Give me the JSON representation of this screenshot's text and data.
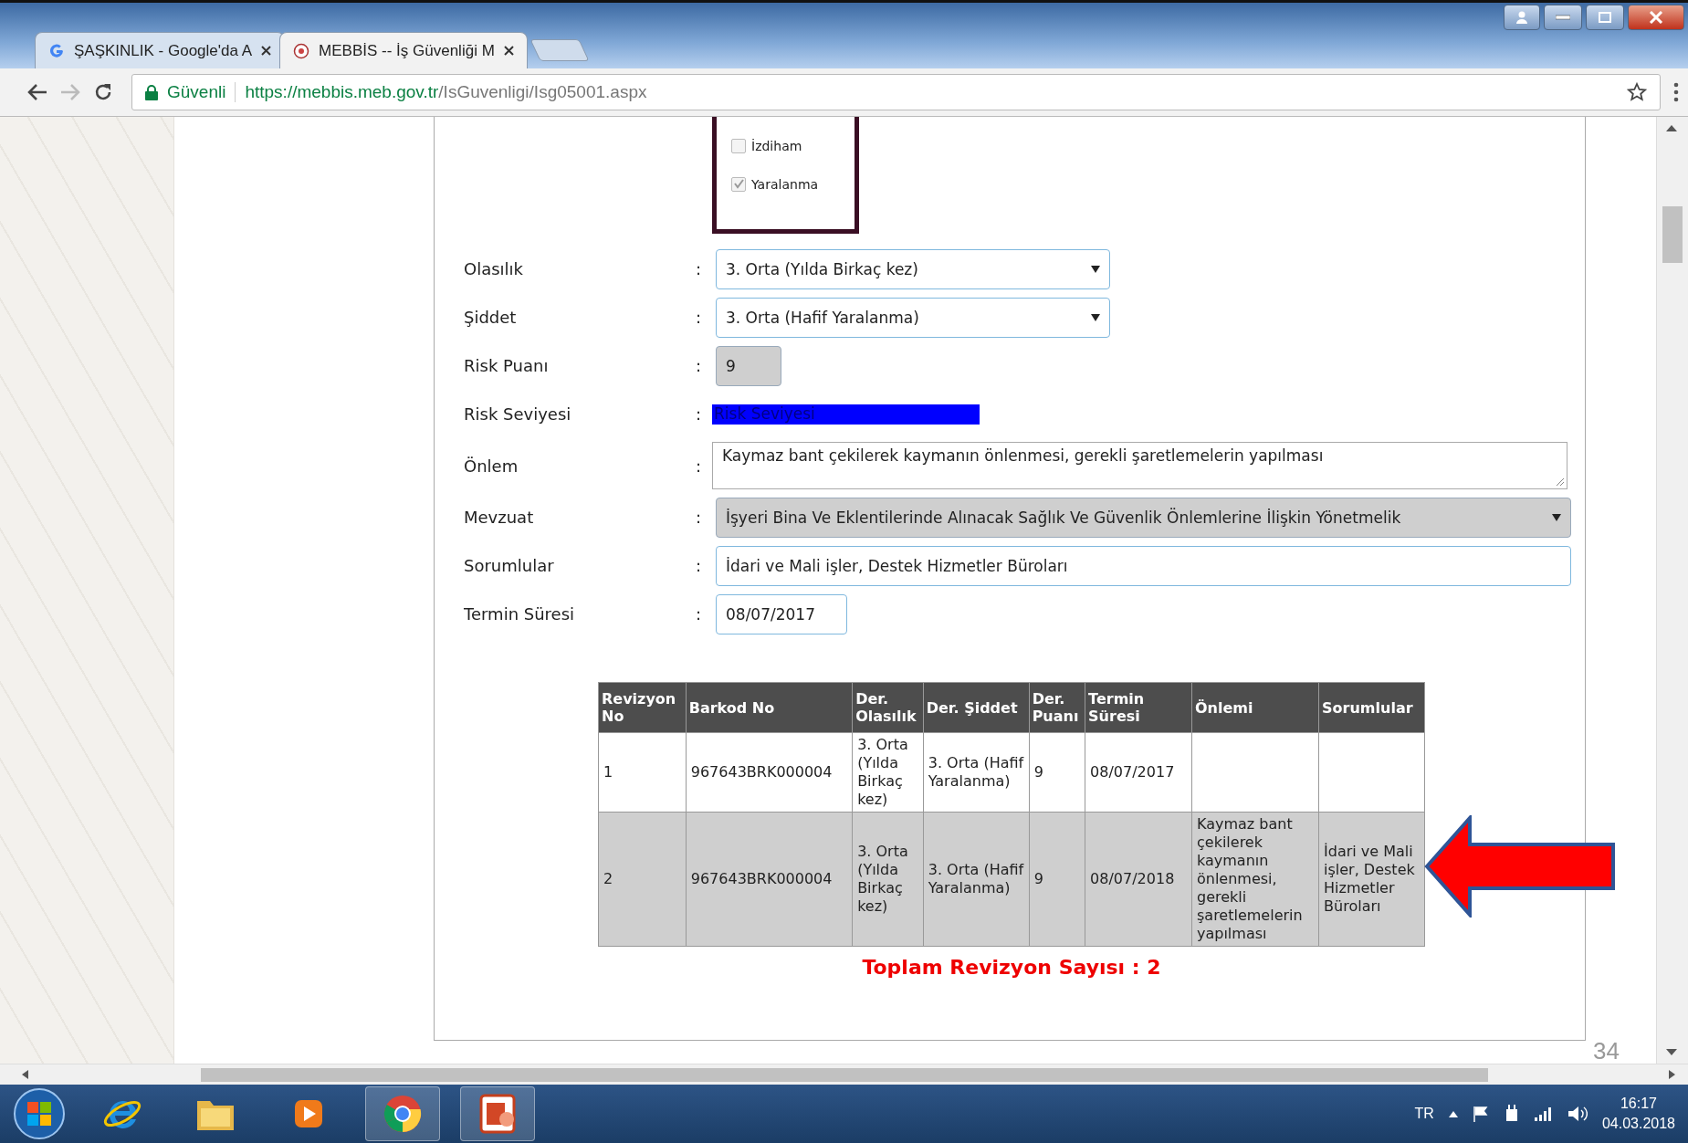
{
  "browser": {
    "tabs": [
      {
        "title": "ŞAŞKINLIK - Google'da A",
        "selected": false
      },
      {
        "title": "MEBBİS -- İş Güvenliği M",
        "selected": true
      }
    ],
    "security_label": "Güvenli",
    "url_host": "https://mebbis.meb.gov.tr",
    "url_path": "/IsGuvenligi/Isg05001.aspx"
  },
  "hazard_checklist": [
    {
      "label": "İzdiham",
      "checked": false
    },
    {
      "label": "Yaralanma",
      "checked": true
    }
  ],
  "form": [
    {
      "kind": "select",
      "label": "Olasılık",
      "separator": ":",
      "value": "3. Orta (Yılda Birkaç kez)",
      "disabled": false
    },
    {
      "kind": "select",
      "label": "Şiddet",
      "separator": ":",
      "value": "3. Orta (Hafif Yaralanma)",
      "disabled": false
    },
    {
      "kind": "short",
      "label": "Risk Puanı",
      "separator": ":",
      "value": "9",
      "disabled": true
    },
    {
      "kind": "badge",
      "label": "Risk Seviyesi",
      "separator": ":",
      "value": "Risk Seviyesi",
      "disabled": false
    },
    {
      "kind": "textarea",
      "label": "Önlem",
      "separator": ":",
      "value": "Kaymaz bant çekilerek kaymanın önlenmesi, gerekli şaretlemelerin yapılması",
      "disabled": false
    },
    {
      "kind": "wide-select",
      "label": "Mevzuat",
      "separator": ":",
      "value": "İşyeri Bina Ve Eklentilerinde Alınacak Sağlık Ve Güvenlik Önlemlerine İlişkin Yönetmelik",
      "disabled": true
    },
    {
      "kind": "wide",
      "label": "Sorumlular",
      "separator": ":",
      "value": "İdari ve Mali işler, Destek Hizmetler Büroları",
      "disabled": false
    },
    {
      "kind": "date",
      "label": "Termin Süresi",
      "separator": ":",
      "value": "08/07/2017",
      "disabled": false
    }
  ],
  "revisions": {
    "columns": [
      "Revizyon No",
      "Barkod No",
      "Der. Olasılık",
      "Der. Şiddet",
      "Der. Puanı",
      "Termin Süresi",
      "Önlemi",
      "Sorumlular"
    ],
    "rows": [
      {
        "selected": false,
        "cells": [
          "1",
          "967643BRK000004",
          "3. Orta (Yılda Birkaç kez)",
          "3. Orta (Hafif Yaralanma)",
          "9",
          "08/07/2017"
        ]
      },
      {
        "selected": true,
        "cells": [
          "2",
          "967643BRK000004",
          "3. Orta (Yılda Birkaç kez)",
          "3. Orta (Hafif Yaralanma)",
          "9",
          "08/07/2018",
          "Kaymaz bant çekilerek kaymanın önlenmesi, gerekli şaretlemelerin yapılması",
          "İdari ve Mali işler, Destek Hizmetler Büroları"
        ]
      }
    ],
    "total": "Toplam Revizyon Sayısı : 2"
  },
  "slide_number": "34",
  "taskbar": {
    "language": "TR",
    "time": "16:17",
    "date": "04.03.2018"
  }
}
